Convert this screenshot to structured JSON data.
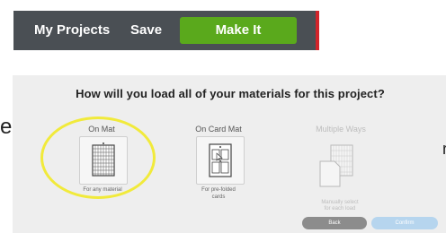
{
  "topbar": {
    "my_projects": "My Projects",
    "save": "Save",
    "make_it": "Make It"
  },
  "left_fragment": "e",
  "dialog": {
    "title": "How will you load all of your materials for this project?",
    "options": [
      {
        "label": "On Mat",
        "sub1": "For any material",
        "sub2": ""
      },
      {
        "label": "On Card Mat",
        "sub1": "For pre-folded",
        "sub2": "cards"
      },
      {
        "label": "Multiple Ways",
        "sub1": "Manually select",
        "sub2": "for each load"
      }
    ],
    "back": "Back",
    "confirm": "Confirm",
    "edge_char": "r"
  },
  "colors": {
    "topbar": "#4a4f54",
    "make_it": "#5aa91c",
    "highlight": "#f1ea3b",
    "confirm": "#b6d5ee",
    "back": "#8c8c8c"
  }
}
